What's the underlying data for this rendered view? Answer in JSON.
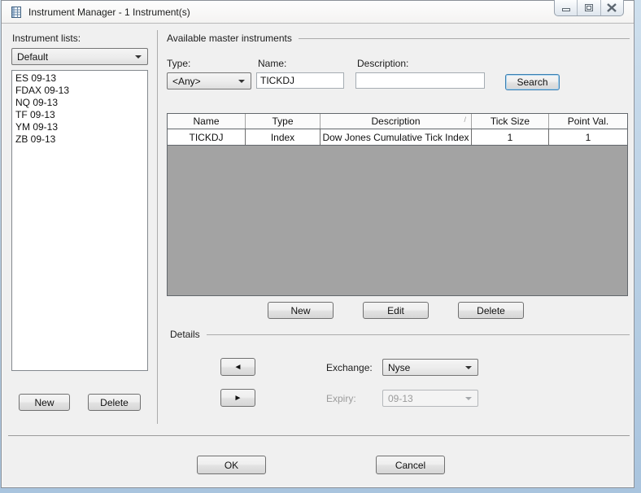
{
  "window": {
    "title": "Instrument Manager - 1 Instrument(s)"
  },
  "left_panel": {
    "label": "Instrument lists:",
    "list_selector_value": "Default",
    "instruments": [
      "ES 09-13",
      "FDAX 09-13",
      "NQ 09-13",
      "TF 09-13",
      "YM 09-13",
      "ZB 09-13"
    ],
    "new_label": "New",
    "delete_label": "Delete"
  },
  "master": {
    "section_title": "Available master instruments",
    "filters": {
      "type_label": "Type:",
      "type_value": "<Any>",
      "name_label": "Name:",
      "name_value": "TICKDJ",
      "description_label": "Description:",
      "description_value": "",
      "search_label": "Search"
    },
    "table": {
      "columns": [
        "Name",
        "Type",
        "Description",
        "Tick Size",
        "Point Val."
      ],
      "rows": [
        [
          "TICKDJ",
          "Index",
          "Dow Jones Cumulative Tick Index",
          "1",
          "1"
        ]
      ],
      "sorted_column": "Description"
    },
    "new_label": "New",
    "edit_label": "Edit",
    "delete_label": "Delete"
  },
  "details": {
    "section_title": "Details",
    "exchange_label": "Exchange:",
    "exchange_value": "Nyse",
    "expiry_label": "Expiry:",
    "expiry_value": "09-13"
  },
  "footer": {
    "ok_label": "OK",
    "cancel_label": "Cancel"
  },
  "icons": {
    "move_left": "◄",
    "move_right": "►",
    "sort_ascending": "/"
  },
  "colors": {
    "search_focus_border": "#3c7fb1",
    "grid_empty_fill": "#a3a3a3",
    "frame_blue": "#bcd2e6"
  }
}
